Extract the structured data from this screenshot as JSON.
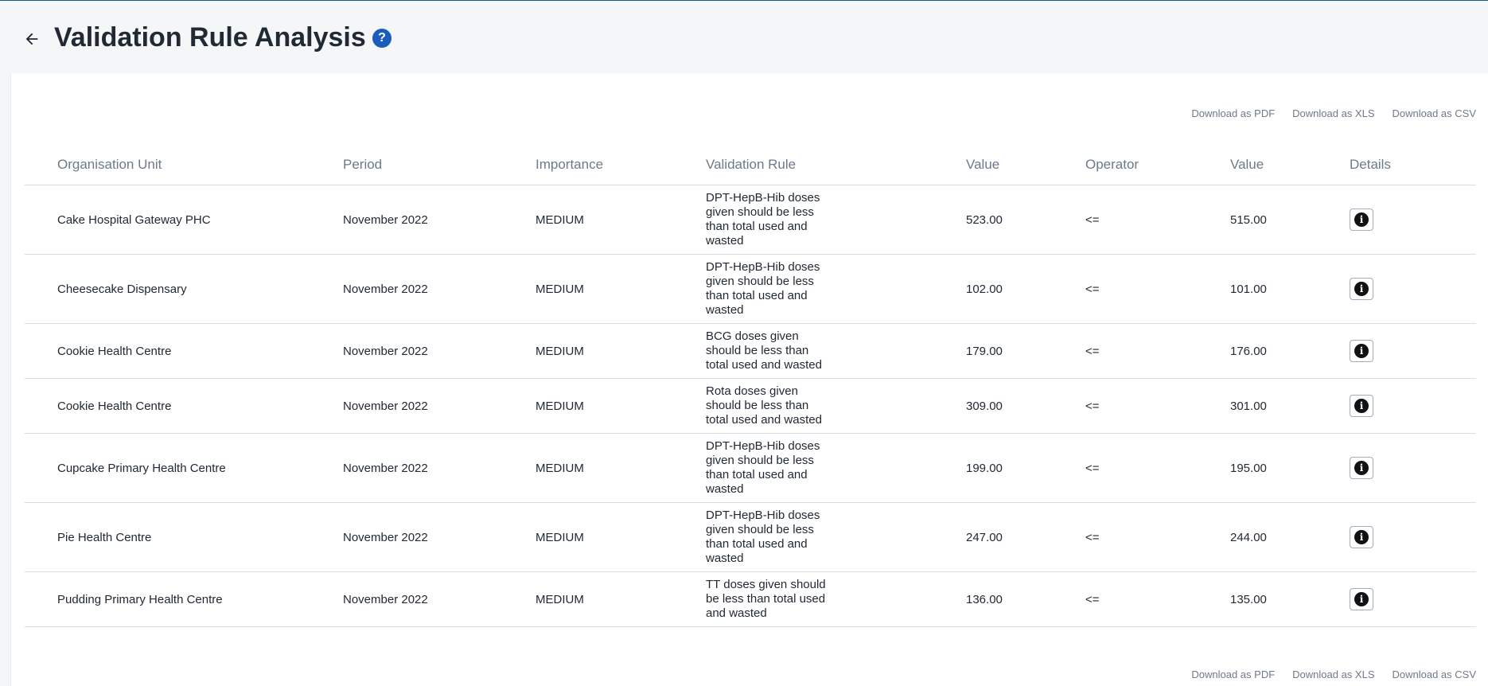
{
  "header": {
    "title": "Validation Rule Analysis",
    "back_icon": "arrow-left-icon",
    "help_icon": "question-circle-icon",
    "help_glyph": "?"
  },
  "downloads": {
    "pdf": "Download as PDF",
    "xls": "Download as XLS",
    "csv": "Download as CSV"
  },
  "table": {
    "columns": [
      "Organisation Unit",
      "Period",
      "Importance",
      "Validation Rule",
      "Value",
      "Operator",
      "Value",
      "Details"
    ],
    "info_glyph": "i",
    "rows": [
      {
        "org_unit": "Cake Hospital Gateway PHC",
        "period": "November 2022",
        "importance": "MEDIUM",
        "rule": "DPT-HepB-Hib doses given should be less than total used and wasted",
        "left_value": "523.00",
        "operator": "<=",
        "right_value": "515.00"
      },
      {
        "org_unit": "Cheesecake Dispensary",
        "period": "November 2022",
        "importance": "MEDIUM",
        "rule": "DPT-HepB-Hib doses given should be less than total used and wasted",
        "left_value": "102.00",
        "operator": "<=",
        "right_value": "101.00"
      },
      {
        "org_unit": "Cookie Health Centre",
        "period": "November 2022",
        "importance": "MEDIUM",
        "rule": "BCG doses given should be less than total used and wasted",
        "left_value": "179.00",
        "operator": "<=",
        "right_value": "176.00"
      },
      {
        "org_unit": "Cookie Health Centre",
        "period": "November 2022",
        "importance": "MEDIUM",
        "rule": "Rota doses given should be less than total used and wasted",
        "left_value": "309.00",
        "operator": "<=",
        "right_value": "301.00"
      },
      {
        "org_unit": "Cupcake Primary Health Centre",
        "period": "November 2022",
        "importance": "MEDIUM",
        "rule": "DPT-HepB-Hib doses given should be less than total used and wasted",
        "left_value": "199.00",
        "operator": "<=",
        "right_value": "195.00"
      },
      {
        "org_unit": "Pie Health Centre",
        "period": "November 2022",
        "importance": "MEDIUM",
        "rule": "DPT-HepB-Hib doses given should be less than total used and wasted",
        "left_value": "247.00",
        "operator": "<=",
        "right_value": "244.00"
      },
      {
        "org_unit": "Pudding Primary Health Centre",
        "period": "November 2022",
        "importance": "MEDIUM",
        "rule": "TT doses given should be less than total used and wasted",
        "left_value": "136.00",
        "operator": "<=",
        "right_value": "135.00"
      }
    ]
  }
}
